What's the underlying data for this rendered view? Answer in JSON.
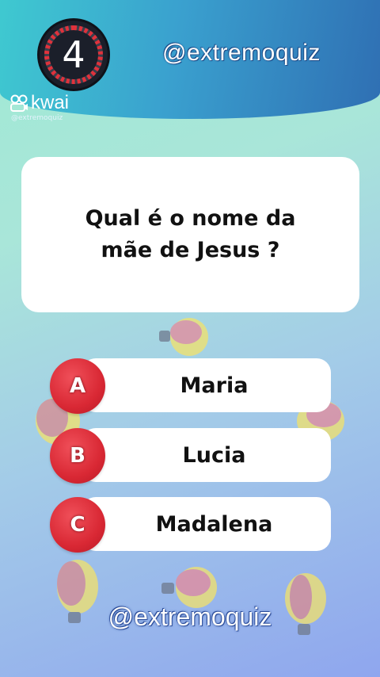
{
  "header": {
    "timer_value": "4",
    "handle": "@extremoquiz",
    "brand": "kwai",
    "brand_sub": "@extremoquiz"
  },
  "question": {
    "text": "Qual é o nome da\nmãe de Jesus ?"
  },
  "answers": [
    {
      "letter": "A",
      "label": "Maria"
    },
    {
      "letter": "B",
      "label": "Lucia"
    },
    {
      "letter": "C",
      "label": "Madalena"
    }
  ],
  "footer": {
    "handle": "@extremoquiz"
  },
  "colors": {
    "badge_red": "#d92834",
    "header_blue": "#2f6fb3",
    "timer_ring": "#e0323c"
  },
  "icons": [
    "lightbulb-brain-icon",
    "kwai-logo-icon"
  ]
}
